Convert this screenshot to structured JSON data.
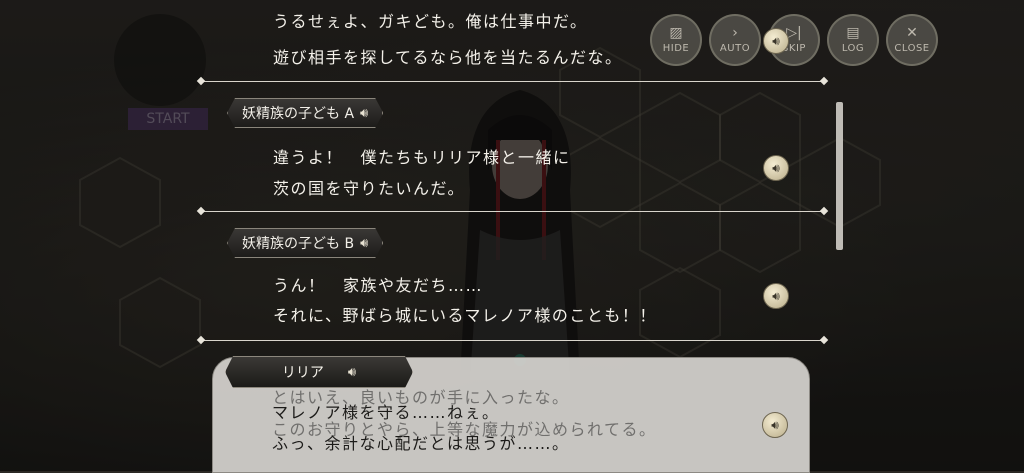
{
  "toolbar": [
    {
      "label": "HIDE",
      "icon": "hide-icon",
      "glyph": "▨"
    },
    {
      "label": "AUTO",
      "icon": "auto-icon",
      "glyph": "›"
    },
    {
      "label": "SKIP",
      "icon": "skip-icon",
      "glyph": "▷|"
    },
    {
      "label": "LOG",
      "icon": "log-icon",
      "glyph": "▤"
    },
    {
      "label": "CLOSE",
      "icon": "close-icon",
      "glyph": "✕"
    }
  ],
  "start_label": "START",
  "log": [
    {
      "speaker": "",
      "lines": [
        "うるせぇよ、ガキども。俺は仕事中だ。",
        "遊び相手を探してるなら他を当たるんだな。"
      ]
    },
    {
      "speaker": "妖精族の子ども A",
      "lines": [
        "違うよ！　僕たちもリリア様と一緒に",
        "茨の国を守りたいんだ。"
      ]
    },
    {
      "speaker": "妖精族の子ども B",
      "lines": [
        "うん！　家族や友だち……",
        "それに、野ばら城にいるマレノア様のことも！！"
      ]
    }
  ],
  "dialog": {
    "speaker": "リリア",
    "ghost_lines": [
      "とはいえ、良いものが手に入ったな。",
      "このお守りとやら、上等な魔力が込められてる。"
    ],
    "lines": [
      "マレノア様を守る……ねぇ。",
      "ふっ、余計な心配だとは思うが……。"
    ]
  },
  "colors": {
    "text": "#f4f1ea",
    "dialog_bg": "#d7d5d0",
    "name_tag": "#2a2927"
  }
}
